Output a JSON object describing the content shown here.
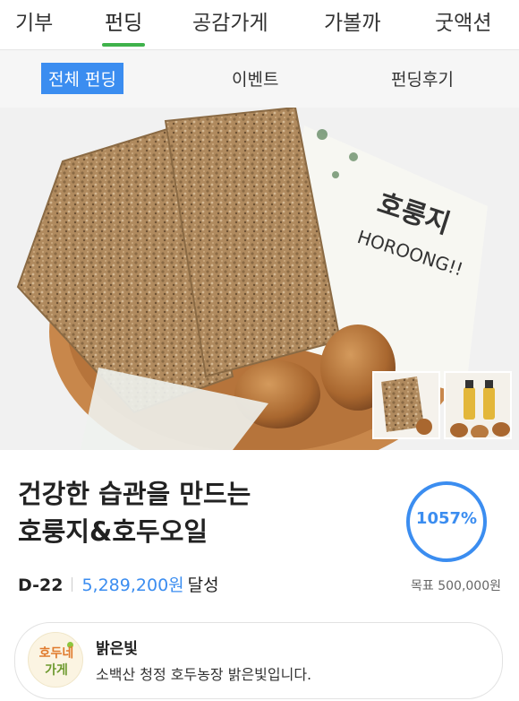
{
  "top_tabs": [
    {
      "label": "기부",
      "active": false
    },
    {
      "label": "펀딩",
      "active": true
    },
    {
      "label": "공감가게",
      "active": false
    },
    {
      "label": "가볼까",
      "active": false
    },
    {
      "label": "굿액션",
      "active": false
    }
  ],
  "sub_tabs": [
    {
      "label": "전체 펀딩",
      "active": true
    },
    {
      "label": "이벤트",
      "active": false
    },
    {
      "label": "펀딩후기",
      "active": false
    }
  ],
  "hero": {
    "package_text_1": "호룽지",
    "package_text_2": "HOROONG!!"
  },
  "project": {
    "title": "건강한 습관을 만드는\n호룽지&호두오일",
    "dday": "D-22",
    "amount": "5,289,200원",
    "achieved_label": "달성",
    "goal": "목표 500,000원",
    "percent_label": "1057%",
    "percent": 1057
  },
  "seller": {
    "logo_line1": "호두네",
    "logo_line2": "가게",
    "name": "밝은빛",
    "description": "소백산 청정 호두농장 밝은빛입니다."
  },
  "colors": {
    "accent_green": "#3fb24b",
    "accent_blue": "#3b8df0"
  }
}
